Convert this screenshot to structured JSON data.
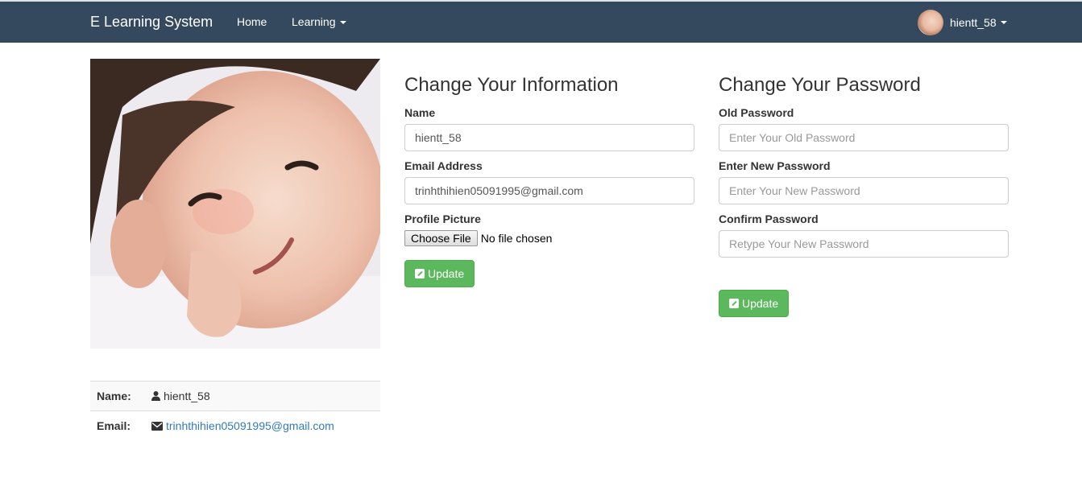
{
  "navbar": {
    "brand": "E Learning System",
    "home": "Home",
    "learning": "Learning",
    "user": "hientt_58"
  },
  "profile_table": {
    "name_label": "Name:",
    "name_value": "hientt_58",
    "email_label": "Email:",
    "email_value": "trinhthihien05091995@gmail.com"
  },
  "info_form": {
    "title": "Change Your Information",
    "name_label": "Name",
    "name_value": "hientt_58",
    "email_label": "Email Address",
    "email_value": "trinhthihien05091995@gmail.com",
    "picture_label": "Profile Picture",
    "choose_file": "Choose File",
    "no_file": "No file chosen",
    "update": "Update"
  },
  "password_form": {
    "title": "Change Your Password",
    "old_label": "Old Password",
    "old_placeholder": "Enter Your Old Password",
    "new_label": "Enter New Password",
    "new_placeholder": "Enter Your New Password",
    "confirm_label": "Confirm Password",
    "confirm_placeholder": "Retype Your New Password",
    "update": "Update"
  },
  "colors": {
    "navbar": "#34495e",
    "success": "#5cb85c",
    "link": "#337ab7"
  }
}
